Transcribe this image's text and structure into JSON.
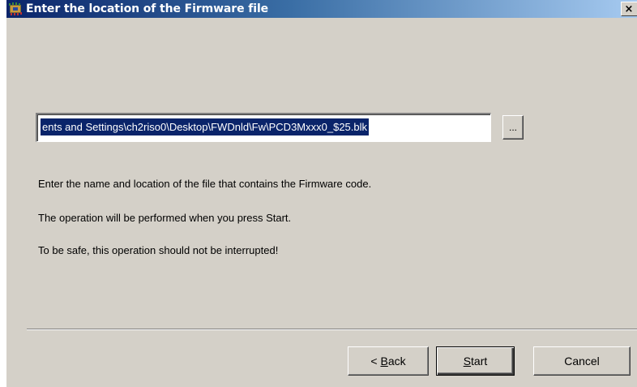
{
  "window": {
    "title": "Enter the location of the Firmware file",
    "close_label": "×"
  },
  "path_field": {
    "value": "ents and Settings\\ch2riso0\\Desktop\\FWDnld\\Fw\\PCD3Mxxx0_$25.blk"
  },
  "browse_button": {
    "label": "..."
  },
  "instructions": [
    "Enter the name and location of the file that contains the Firmware code.",
    "The operation will be performed when you press Start.",
    "To be safe, this operation should not be interrupted!"
  ],
  "buttons": {
    "back": {
      "prefix": "< ",
      "mnemonic": "B",
      "rest": "ack"
    },
    "start": {
      "prefix": "",
      "mnemonic": "S",
      "rest": "tart"
    },
    "cancel": {
      "label": "Cancel"
    }
  },
  "colors": {
    "title_start": "#0a246a",
    "title_end": "#a6caf0",
    "dialog_bg": "#d4d0c8",
    "selection_bg": "#0a246a"
  },
  "icons": {
    "app": "firmware-app-icon",
    "close": "close-icon"
  }
}
